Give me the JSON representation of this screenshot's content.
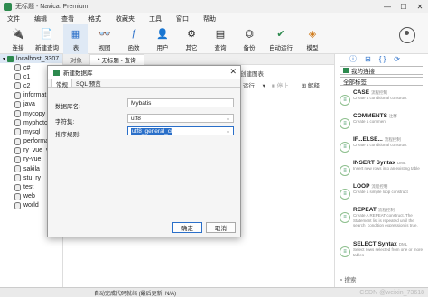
{
  "window": {
    "title": "无标题 - Navicat Premium",
    "controls": [
      "—",
      "☐",
      "✕"
    ]
  },
  "menu": [
    "文件",
    "编辑",
    "查看",
    "格式",
    "收藏夹",
    "工具",
    "窗口",
    "帮助"
  ],
  "toolbar": [
    {
      "label": "连接",
      "icon": "plug-icon",
      "glyph": "🔌"
    },
    {
      "label": "新建查询",
      "icon": "new-query-icon",
      "glyph": "📄"
    },
    {
      "label": "表",
      "icon": "table-icon",
      "glyph": "▦"
    },
    {
      "label": "视图",
      "icon": "view-icon",
      "glyph": "👓"
    },
    {
      "label": "函数",
      "icon": "function-icon",
      "glyph": "ƒ"
    },
    {
      "label": "用户",
      "icon": "user-icon",
      "glyph": "👤"
    },
    {
      "label": "其它",
      "icon": "other-icon",
      "glyph": "⚙"
    },
    {
      "label": "查询",
      "icon": "query-icon",
      "glyph": "▤"
    },
    {
      "label": "备份",
      "icon": "backup-icon",
      "glyph": "⏣"
    },
    {
      "label": "自动运行",
      "icon": "auto-run-icon",
      "glyph": "✔"
    },
    {
      "label": "模型",
      "icon": "model-icon",
      "glyph": "◈"
    }
  ],
  "sidebar": {
    "connection": "localhost_3307",
    "databases": [
      "c#",
      "c1",
      "c2",
      "informat",
      "java",
      "mycopy",
      "myphoto",
      "mysql",
      "performa",
      "ry_vue_v",
      "ry-vue",
      "sakila",
      "stu_ry",
      "test",
      "web",
      "world"
    ]
  },
  "tabs": [
    "对象",
    "* 无标题 - 查询"
  ],
  "editor_toolbar": {
    "create_chart": "创建图表",
    "run": "运行",
    "stop": "停止",
    "explain": "解释"
  },
  "right_panel": {
    "connection_select": "我的连接",
    "tag_select": "全部标签",
    "search": "搜索",
    "snippets": [
      {
        "name": "CASE",
        "tag": "流程控制",
        "desc": "Create a conditional construct"
      },
      {
        "name": "COMMENTS",
        "tag": "注释",
        "desc": "Create a comment"
      },
      {
        "name": "IF...ELSE...",
        "tag": "流程控制",
        "desc": "Create a conditional construct"
      },
      {
        "name": "INSERT Syntax",
        "tag": "DML",
        "desc": "Insert new rows into an existing table"
      },
      {
        "name": "LOOP",
        "tag": "流程控制",
        "desc": "Create a simple loop construct"
      },
      {
        "name": "REPEAT",
        "tag": "流程控制",
        "desc": "Create A REPEAT construct. The Statement list is repeated until the search_condition expression is true."
      },
      {
        "name": "SELECT Syntax",
        "tag": "DML",
        "desc": "Select rows selected from one or more tables"
      }
    ]
  },
  "dialog": {
    "title": "新建数据库",
    "tabs": [
      "常规",
      "SQL 预览"
    ],
    "fields": {
      "name_label": "数据库名:",
      "name_value": "Mybatis",
      "charset_label": "字符集:",
      "charset_value": "utf8",
      "collation_label": "排序规则:",
      "collation_value": "utf8_general_ci"
    },
    "ok": "确定",
    "cancel": "取消"
  },
  "status": {
    "text": "自动完成代码就绪 (最后更新: N/A)",
    "watermark": "CSDN @weixin_73618"
  }
}
